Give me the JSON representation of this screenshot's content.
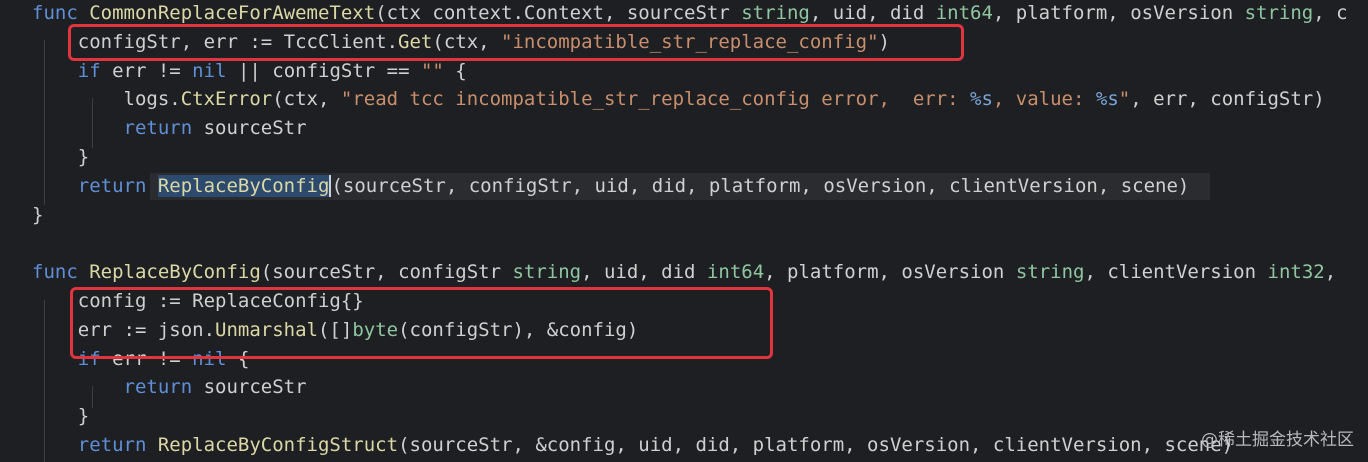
{
  "code_lines": [
    {
      "tokens": [
        {
          "t": "func ",
          "c": "kw"
        },
        {
          "t": "CommonReplaceForAwemeText",
          "c": "fn"
        },
        {
          "t": "(ctx context.Context, sourceStr ",
          "c": "pl"
        },
        {
          "t": "string",
          "c": "ty"
        },
        {
          "t": ", uid, did ",
          "c": "pl"
        },
        {
          "t": "int64",
          "c": "ty"
        },
        {
          "t": ", platform, osVersion ",
          "c": "pl"
        },
        {
          "t": "string",
          "c": "ty"
        },
        {
          "t": ", c",
          "c": "pl"
        }
      ]
    },
    {
      "tokens": [
        {
          "t": "    configStr, err := TccClient.",
          "c": "pl"
        },
        {
          "t": "Get",
          "c": "fn"
        },
        {
          "t": "(ctx, ",
          "c": "pl"
        },
        {
          "t": "\"incompatible_str_replace_config\"",
          "c": "str"
        },
        {
          "t": ")",
          "c": "pl"
        }
      ]
    },
    {
      "tokens": [
        {
          "t": "    ",
          "c": "pl"
        },
        {
          "t": "if ",
          "c": "kw"
        },
        {
          "t": "err != ",
          "c": "pl"
        },
        {
          "t": "nil",
          "c": "kw"
        },
        {
          "t": " || configStr == ",
          "c": "pl"
        },
        {
          "t": "\"\"",
          "c": "str"
        },
        {
          "t": " {",
          "c": "pl"
        }
      ]
    },
    {
      "tokens": [
        {
          "t": "        logs.",
          "c": "pl"
        },
        {
          "t": "CtxError",
          "c": "fn"
        },
        {
          "t": "(ctx, ",
          "c": "pl"
        },
        {
          "t": "\"read tcc incompatible_str_replace_config error,  err: ",
          "c": "str"
        },
        {
          "t": "%s",
          "c": "fmt"
        },
        {
          "t": ", value: ",
          "c": "str"
        },
        {
          "t": "%s",
          "c": "fmt"
        },
        {
          "t": "\"",
          "c": "str"
        },
        {
          "t": ", err, configStr)",
          "c": "pl"
        }
      ]
    },
    {
      "tokens": [
        {
          "t": "        ",
          "c": "pl"
        },
        {
          "t": "return ",
          "c": "kw"
        },
        {
          "t": "sourceStr",
          "c": "pl"
        }
      ]
    },
    {
      "tokens": [
        {
          "t": "    }",
          "c": "pl"
        }
      ]
    },
    {
      "tokens": [
        {
          "t": "    ",
          "c": "pl"
        },
        {
          "t": "return ",
          "c": "kw"
        },
        {
          "t": "ReplaceByConfig",
          "c": "fn sel"
        },
        {
          "t": "(sourceStr, configStr, uid, did, platform, osVersion, clientVersion, scene)",
          "c": "pl"
        }
      ]
    },
    {
      "tokens": [
        {
          "t": "}",
          "c": "pl"
        }
      ]
    },
    {
      "tokens": []
    },
    {
      "tokens": [
        {
          "t": "func ",
          "c": "kw"
        },
        {
          "t": "ReplaceByConfig",
          "c": "fn"
        },
        {
          "t": "(sourceStr, configStr ",
          "c": "pl"
        },
        {
          "t": "string",
          "c": "ty"
        },
        {
          "t": ", uid, did ",
          "c": "pl"
        },
        {
          "t": "int64",
          "c": "ty"
        },
        {
          "t": ", platform, osVersion ",
          "c": "pl"
        },
        {
          "t": "string",
          "c": "ty"
        },
        {
          "t": ", clientVersion ",
          "c": "pl"
        },
        {
          "t": "int32",
          "c": "ty"
        },
        {
          "t": ",",
          "c": "pl"
        }
      ]
    },
    {
      "tokens": [
        {
          "t": "    config := ReplaceConfig{}",
          "c": "pl"
        }
      ]
    },
    {
      "tokens": [
        {
          "t": "    err := json.",
          "c": "pl"
        },
        {
          "t": "Unmarshal",
          "c": "fn"
        },
        {
          "t": "([]",
          "c": "pl"
        },
        {
          "t": "byte",
          "c": "ty"
        },
        {
          "t": "(configStr), &config)",
          "c": "pl"
        }
      ]
    },
    {
      "tokens": [
        {
          "t": "    ",
          "c": "pl"
        },
        {
          "t": "if ",
          "c": "kw"
        },
        {
          "t": "err != ",
          "c": "pl"
        },
        {
          "t": "nil",
          "c": "kw"
        },
        {
          "t": " {",
          "c": "pl"
        }
      ]
    },
    {
      "tokens": [
        {
          "t": "        ",
          "c": "pl"
        },
        {
          "t": "return ",
          "c": "kw"
        },
        {
          "t": "sourceStr",
          "c": "pl"
        }
      ]
    },
    {
      "tokens": [
        {
          "t": "    }",
          "c": "pl"
        }
      ]
    },
    {
      "tokens": [
        {
          "t": "    ",
          "c": "pl"
        },
        {
          "t": "return ",
          "c": "kw"
        },
        {
          "t": "ReplaceByConfigStruct",
          "c": "fn"
        },
        {
          "t": "(sourceStr, &config, uid, did, platform, osVersion, clientVersion, scene)",
          "c": "pl"
        }
      ]
    }
  ],
  "watermark": "@稀土掘金技术社区",
  "colors": {
    "background": "#1e1f22",
    "keyword": "#5f8fd6",
    "function": "#dcd8a6",
    "type": "#8fc6a0",
    "string": "#c98f6d",
    "highlight_box": "#e0343f"
  }
}
